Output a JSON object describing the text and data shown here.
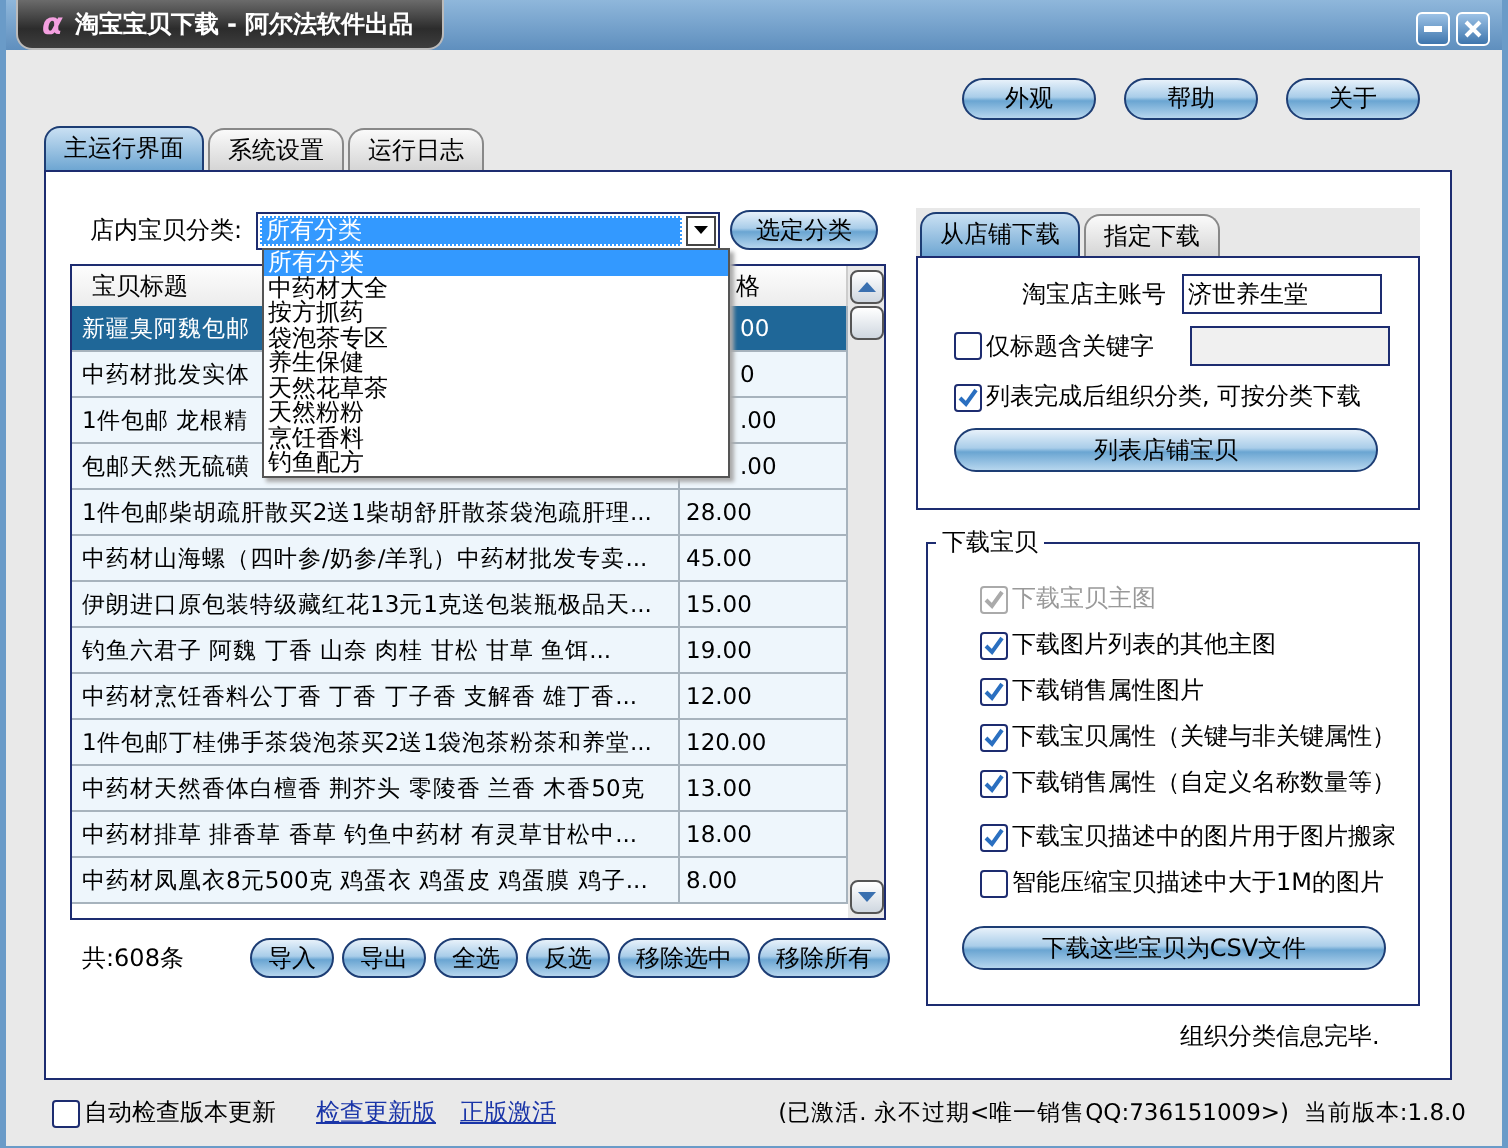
{
  "window": {
    "logo": "α",
    "title": "淘宝宝贝下载 - 阿尔法软件出品"
  },
  "top_buttons": [
    "外观",
    "帮助",
    "关于"
  ],
  "tabs": [
    {
      "label": "主运行界面",
      "selected": true
    },
    {
      "label": "系统设置",
      "selected": false
    },
    {
      "label": "运行日志",
      "selected": false
    }
  ],
  "category": {
    "label": "店内宝贝分类:",
    "value": "所有分类",
    "button": "选定分类",
    "expanded": true,
    "options": [
      {
        "label": "所有分类",
        "selected": true
      },
      {
        "label": "中药材大全",
        "selected": false
      },
      {
        "label": "按方抓药",
        "selected": false
      },
      {
        "label": "袋泡茶专区",
        "selected": false
      },
      {
        "label": "养生保健",
        "selected": false
      },
      {
        "label": "天然花草茶",
        "selected": false
      },
      {
        "label": "天然粉粉",
        "selected": false
      },
      {
        "label": "烹饪香料",
        "selected": false
      },
      {
        "label": "钓鱼配方",
        "selected": false
      }
    ]
  },
  "table": {
    "columns": [
      "宝贝标题",
      "格"
    ],
    "rows": [
      {
        "title": "新疆臭阿魏包邮",
        "price": "00",
        "selected": true,
        "partly_hidden": true
      },
      {
        "title": "中药材批发实体",
        "price": "0",
        "selected": false,
        "partly_hidden": true
      },
      {
        "title": "1件包邮 龙根精",
        "price": ".00",
        "selected": false,
        "partly_hidden": true
      },
      {
        "title": "包邮天然无硫磺",
        "price": ".00",
        "selected": false,
        "partly_hidden": true
      },
      {
        "title": "1件包邮柴胡疏肝散买2送1柴胡舒肝散茶袋泡疏肝理...",
        "price": "28.00",
        "selected": false,
        "partly_hidden": false
      },
      {
        "title": "中药材山海螺（四叶参/奶参/羊乳）中药材批发专卖...",
        "price": "45.00",
        "selected": false,
        "partly_hidden": false
      },
      {
        "title": "伊朗进口原包装特级藏红花13元1克送包装瓶极品天...",
        "price": "15.00",
        "selected": false,
        "partly_hidden": false
      },
      {
        "title": "钓鱼六君子 阿魏 丁香 山奈 肉桂 甘松 甘草 鱼饵...",
        "price": "19.00",
        "selected": false,
        "partly_hidden": false
      },
      {
        "title": "中药材烹饪香料公丁香 丁香 丁子香 支解香 雄丁香...",
        "price": "12.00",
        "selected": false,
        "partly_hidden": false
      },
      {
        "title": "1件包邮丁桂佛手茶袋泡茶买2送1袋泡茶粉茶和养堂...",
        "price": "120.00",
        "selected": false,
        "partly_hidden": false
      },
      {
        "title": "中药材天然香体白檀香 荆芥头 零陵香 兰香 木香50克",
        "price": "13.00",
        "selected": false,
        "partly_hidden": false
      },
      {
        "title": "中药材排草 排香草 香草 钓鱼中药材 有灵草甘松中...",
        "price": "18.00",
        "selected": false,
        "partly_hidden": false
      },
      {
        "title": "中药材凤凰衣8元500克 鸡蛋衣 鸡蛋皮 鸡蛋膜 鸡子...",
        "price": "8.00",
        "selected": false,
        "partly_hidden": false
      }
    ]
  },
  "count": "共:608条",
  "list_buttons": [
    "导入",
    "导出",
    "全选",
    "反选",
    "移除选中",
    "移除所有"
  ],
  "source_tabs": [
    {
      "label": "从店铺下载",
      "selected": true
    },
    {
      "label": "指定下载",
      "selected": false
    }
  ],
  "shop": {
    "account_label": "淘宝店主账号",
    "account_value": "济世养生堂",
    "keyword": {
      "label": "仅标题含关键字",
      "checked": false
    },
    "organize": {
      "label": "列表完成后组织分类, 可按分类下载",
      "checked": true
    },
    "button": "列表店铺宝贝"
  },
  "download": {
    "title": "下载宝贝",
    "options": [
      {
        "label": "下载宝贝主图",
        "checked": true,
        "disabled": true
      },
      {
        "label": "下载图片列表的其他主图",
        "checked": true,
        "disabled": false
      },
      {
        "label": "下载销售属性图片",
        "checked": true,
        "disabled": false
      },
      {
        "label": "下载宝贝属性（关键与非关键属性）",
        "checked": true,
        "disabled": false
      },
      {
        "label": "下载销售属性（自定义名称数量等）",
        "checked": true,
        "disabled": false
      },
      {
        "label": "下载宝贝描述中的图片用于图片搬家",
        "checked": true,
        "disabled": false
      },
      {
        "label": "智能压缩宝贝描述中大于1M的图片",
        "checked": false,
        "disabled": false
      }
    ],
    "button": "下载这些宝贝为CSV文件"
  },
  "status": "组织分类信息完毕.",
  "footer": {
    "auto_update": {
      "label": "自动检查版本更新",
      "checked": false
    },
    "links": [
      "检查更新版",
      "正版激活"
    ],
    "info": "(已激活. 永不过期<唯一销售QQ:736151009>)  当前版本:1.8.0"
  }
}
